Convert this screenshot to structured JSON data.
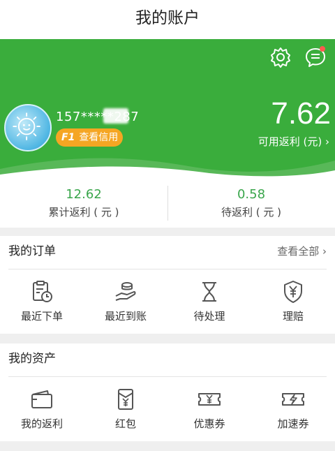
{
  "header": {
    "title": "我的账户"
  },
  "profile": {
    "phone": "157*****287",
    "credit_badge": {
      "tag": "F1",
      "text": "查看信用"
    },
    "balance": "7.62",
    "balance_label": "可用返利 (元) ›"
  },
  "stats": [
    {
      "value": "12.62",
      "label": "累计返利 ( 元 )"
    },
    {
      "value": "0.58",
      "label": "待返利 ( 元 )"
    }
  ],
  "orders": {
    "title": "我的订单",
    "more": "查看全部 ›",
    "items": [
      {
        "label": "最近下单",
        "icon": "clipboard-clock-icon"
      },
      {
        "label": "最近到账",
        "icon": "coins-hand-icon"
      },
      {
        "label": "待处理",
        "icon": "hourglass-icon"
      },
      {
        "label": "理赔",
        "icon": "yen-shield-icon"
      }
    ]
  },
  "assets": {
    "title": "我的资产",
    "items": [
      {
        "label": "我的返利",
        "icon": "wallet-icon"
      },
      {
        "label": "红包",
        "icon": "red-envelope-icon"
      },
      {
        "label": "优惠券",
        "icon": "coupon-icon"
      },
      {
        "label": "加速券",
        "icon": "speed-coupon-icon"
      }
    ]
  },
  "colors": {
    "brand_green": "#3aad3c",
    "stat_green": "#3aa64c",
    "badge_orange": "#f5a623",
    "notify_red": "#ff5a4f"
  }
}
